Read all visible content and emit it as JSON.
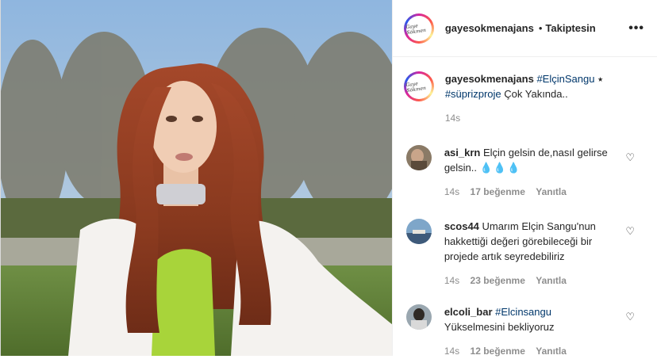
{
  "header": {
    "username": "gayesokmenajans",
    "separator": "•",
    "follow_label": "Takiptesin",
    "more_label": "•••",
    "avatar_text": "Gaye Sökmen"
  },
  "caption": {
    "username": "gayesokmenajans",
    "tag1": "#ElçinSangu",
    "star": "⭑",
    "tag2": "#süprizproje",
    "text": "Çok Yakında..",
    "time": "14s"
  },
  "comments": [
    {
      "username": "asi_krn",
      "text": "Elçin gelsin de,nasıl gelirse gelsin..",
      "emoji": "💧💧💧",
      "time": "14s",
      "likes": "17 beğenme",
      "reply": "Yanıtla"
    },
    {
      "username": "scos44",
      "text": "Umarım Elçin Sangu'nun hakkettiği değeri görebileceği bir projede artık seyredebiliriz",
      "time": "14s",
      "likes": "23 beğenme",
      "reply": "Yanıtla"
    },
    {
      "username": "elcoli_bar",
      "tag": "#Elcinsangu",
      "text": "Yükselmesini bekliyoruz",
      "time": "14s",
      "likes": "12 beğenme",
      "reply": "Yanıtla"
    }
  ],
  "icons": {
    "heart": "heart-outline-icon",
    "more": "more-options-icon"
  },
  "colors": {
    "link": "#00376b",
    "muted": "#8e8e8e",
    "text": "#262626"
  }
}
